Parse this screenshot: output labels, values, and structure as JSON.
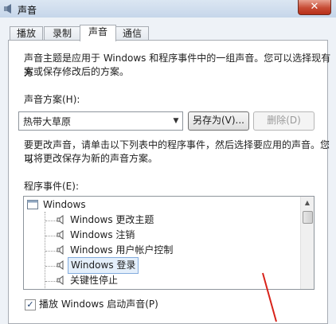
{
  "window": {
    "title": "声音",
    "close_glyph": "✕"
  },
  "tabs": [
    {
      "label": "播放"
    },
    {
      "label": "录制"
    },
    {
      "label": "声音"
    },
    {
      "label": "通信"
    }
  ],
  "sound_panel": {
    "intro_line1": "声音主题是应用于 Windows 和程序事件中的一组声音。您可以选择现有方",
    "intro_line2": "案或保存修改后的方案。",
    "scheme_label": "声音方案(H):",
    "scheme_value": "热带大草原",
    "save_as_button": "另存为(V)...",
    "delete_button": "删除(D)",
    "change_line1": "要更改声音，请单击以下列表中的程序事件，然后选择要应用的声音。您可",
    "change_line2": "以将更改保存为新的声音方案。",
    "events_label": "程序事件(E):",
    "events": [
      {
        "label": "Windows"
      },
      {
        "label": "Windows 更改主题"
      },
      {
        "label": "Windows 注销"
      },
      {
        "label": "Windows 用户帐户控制"
      },
      {
        "label": "Windows 登录"
      },
      {
        "label": "关键性停止"
      }
    ],
    "startup_checkbox_label": "播放 Windows 启动声音(P)",
    "startup_checked": true
  },
  "colors": {
    "accent": "#84acdd",
    "annotation": "#d8231a"
  }
}
